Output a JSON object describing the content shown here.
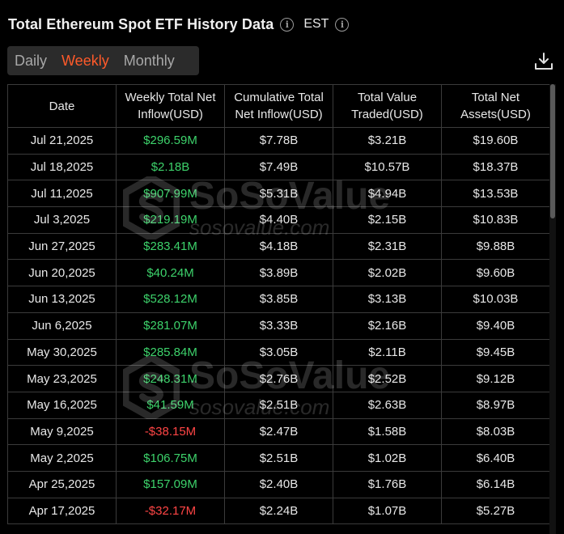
{
  "header": {
    "title": "Total Ethereum Spot ETF History Data",
    "timezone": "EST"
  },
  "tabs": [
    {
      "label": "Daily",
      "active": false
    },
    {
      "label": "Weekly",
      "active": true
    },
    {
      "label": "Monthly",
      "active": false
    }
  ],
  "colors": {
    "accent": "#ff5a2a",
    "positive": "#3dd26b",
    "negative": "#ff4545",
    "background": "#000000"
  },
  "watermark": {
    "brand": "SoSoValue",
    "url": "sosovalue.com"
  },
  "table": {
    "columns": [
      "Date",
      "Weekly Total Net Inflow(USD)",
      "Cumulative Total Net Inflow(USD)",
      "Total Value Traded(USD)",
      "Total Net Assets(USD)"
    ],
    "rows": [
      {
        "date": "Jul 21,2025",
        "inflow": "$296.59M",
        "cumulative": "$7.78B",
        "traded": "$3.21B",
        "assets": "$19.60B",
        "sign": "pos"
      },
      {
        "date": "Jul 18,2025",
        "inflow": "$2.18B",
        "cumulative": "$7.49B",
        "traded": "$10.57B",
        "assets": "$18.37B",
        "sign": "pos"
      },
      {
        "date": "Jul 11,2025",
        "inflow": "$907.99M",
        "cumulative": "$5.31B",
        "traded": "$4.94B",
        "assets": "$13.53B",
        "sign": "pos"
      },
      {
        "date": "Jul 3,2025",
        "inflow": "$219.19M",
        "cumulative": "$4.40B",
        "traded": "$2.15B",
        "assets": "$10.83B",
        "sign": "pos"
      },
      {
        "date": "Jun 27,2025",
        "inflow": "$283.41M",
        "cumulative": "$4.18B",
        "traded": "$2.31B",
        "assets": "$9.88B",
        "sign": "pos"
      },
      {
        "date": "Jun 20,2025",
        "inflow": "$40.24M",
        "cumulative": "$3.89B",
        "traded": "$2.02B",
        "assets": "$9.60B",
        "sign": "pos"
      },
      {
        "date": "Jun 13,2025",
        "inflow": "$528.12M",
        "cumulative": "$3.85B",
        "traded": "$3.13B",
        "assets": "$10.03B",
        "sign": "pos"
      },
      {
        "date": "Jun 6,2025",
        "inflow": "$281.07M",
        "cumulative": "$3.33B",
        "traded": "$2.16B",
        "assets": "$9.40B",
        "sign": "pos"
      },
      {
        "date": "May 30,2025",
        "inflow": "$285.84M",
        "cumulative": "$3.05B",
        "traded": "$2.11B",
        "assets": "$9.45B",
        "sign": "pos"
      },
      {
        "date": "May 23,2025",
        "inflow": "$248.31M",
        "cumulative": "$2.76B",
        "traded": "$2.52B",
        "assets": "$9.12B",
        "sign": "pos"
      },
      {
        "date": "May 16,2025",
        "inflow": "$41.59M",
        "cumulative": "$2.51B",
        "traded": "$2.63B",
        "assets": "$8.97B",
        "sign": "pos"
      },
      {
        "date": "May 9,2025",
        "inflow": "-$38.15M",
        "cumulative": "$2.47B",
        "traded": "$1.58B",
        "assets": "$8.03B",
        "sign": "neg"
      },
      {
        "date": "May 2,2025",
        "inflow": "$106.75M",
        "cumulative": "$2.51B",
        "traded": "$1.02B",
        "assets": "$6.40B",
        "sign": "pos"
      },
      {
        "date": "Apr 25,2025",
        "inflow": "$157.09M",
        "cumulative": "$2.40B",
        "traded": "$1.76B",
        "assets": "$6.14B",
        "sign": "pos"
      },
      {
        "date": "Apr 17,2025",
        "inflow": "-$32.17M",
        "cumulative": "$2.24B",
        "traded": "$1.07B",
        "assets": "$5.27B",
        "sign": "neg"
      }
    ]
  }
}
